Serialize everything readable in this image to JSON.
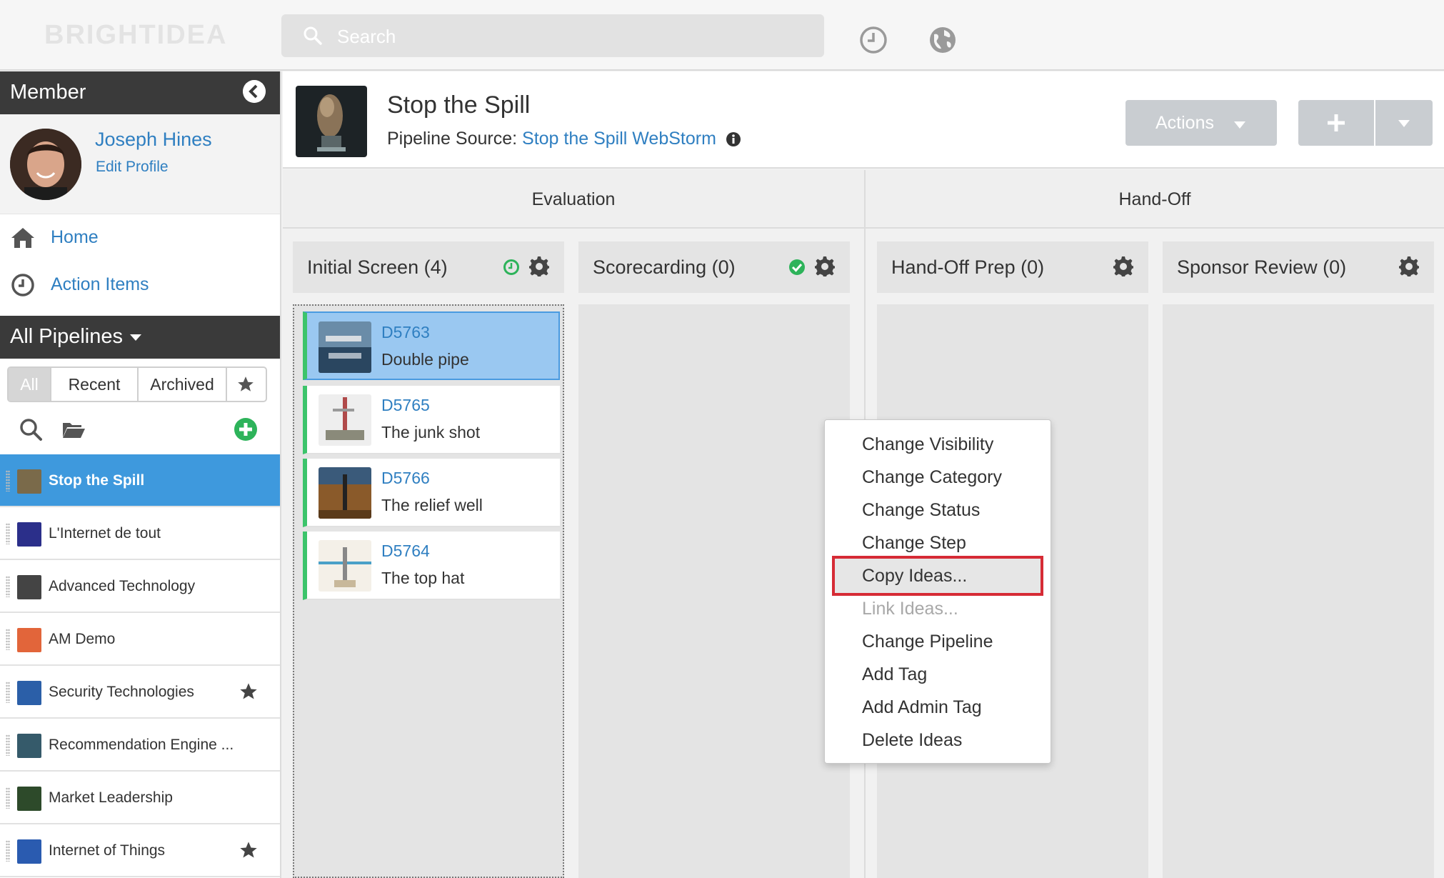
{
  "app": {
    "logo": "BRIGHTIDEA",
    "search_placeholder": "Search"
  },
  "sidebar": {
    "member_header": "Member",
    "profile": {
      "name": "Joseph Hines",
      "edit_label": "Edit Profile"
    },
    "nav": [
      {
        "label": "Home",
        "icon": "home-icon"
      },
      {
        "label": "Action Items",
        "icon": "clock-icon"
      }
    ],
    "pipelines_header": "All Pipelines",
    "filters": [
      "All",
      "Recent",
      "Archived"
    ],
    "active_filter": "All",
    "pipelines": [
      {
        "name": "Stop the Spill",
        "selected": true,
        "starred": false,
        "color": "#7a6a4a"
      },
      {
        "name": "L'Internet de tout",
        "selected": false,
        "starred": false,
        "color": "#2b2f8a"
      },
      {
        "name": "Advanced Technology",
        "selected": false,
        "starred": false,
        "color": "#444444"
      },
      {
        "name": "AM Demo",
        "selected": false,
        "starred": false,
        "color": "#e2653a"
      },
      {
        "name": "Security Technologies",
        "selected": false,
        "starred": true,
        "color": "#2b5fa8"
      },
      {
        "name": "Recommendation Engine ...",
        "selected": false,
        "starred": false,
        "color": "#355a6a"
      },
      {
        "name": "Market Leadership",
        "selected": false,
        "starred": false,
        "color": "#2d4a2a"
      },
      {
        "name": "Internet of Things",
        "selected": false,
        "starred": true,
        "color": "#2a5bb0"
      }
    ]
  },
  "main": {
    "title": "Stop the Spill",
    "source_label": "Pipeline Source:",
    "source_link": "Stop the Spill WebStorm",
    "actions_label": "Actions",
    "stages": [
      {
        "name": "Evaluation"
      },
      {
        "name": "Hand-Off"
      }
    ],
    "columns": [
      {
        "name": "Initial Screen",
        "count": "(4)",
        "status": "clock"
      },
      {
        "name": "Scorecarding",
        "count": "(0)",
        "status": "check"
      },
      {
        "name": "Hand-Off Prep",
        "count": "(0)",
        "status": ""
      },
      {
        "name": "Sponsor Review",
        "count": "(0)",
        "status": ""
      }
    ],
    "cards": [
      {
        "id": "D5763",
        "title": "Double pipe",
        "selected": true
      },
      {
        "id": "D5765",
        "title": "The junk shot",
        "selected": false
      },
      {
        "id": "D5766",
        "title": "The relief well",
        "selected": false
      },
      {
        "id": "D5764",
        "title": "The top hat",
        "selected": false
      }
    ]
  },
  "context_menu": {
    "items": [
      {
        "label": "Change Visibility",
        "enabled": true
      },
      {
        "label": "Change Category",
        "enabled": true
      },
      {
        "label": "Change Status",
        "enabled": true
      },
      {
        "label": "Change Step",
        "enabled": true
      },
      {
        "label": "Copy Ideas...",
        "enabled": true,
        "highlighted": true
      },
      {
        "label": "Link Ideas...",
        "enabled": false
      },
      {
        "label": "Change Pipeline",
        "enabled": true
      },
      {
        "label": "Add Tag",
        "enabled": true
      },
      {
        "label": "Add Admin Tag",
        "enabled": true
      },
      {
        "label": "Delete Ideas",
        "enabled": true
      }
    ]
  },
  "colors": {
    "link": "#2f7fc1",
    "selected_pipeline": "#3e99dd",
    "card_accent": "#3cc46b",
    "highlight_border": "#d62b35",
    "status_green": "#2db35a"
  }
}
